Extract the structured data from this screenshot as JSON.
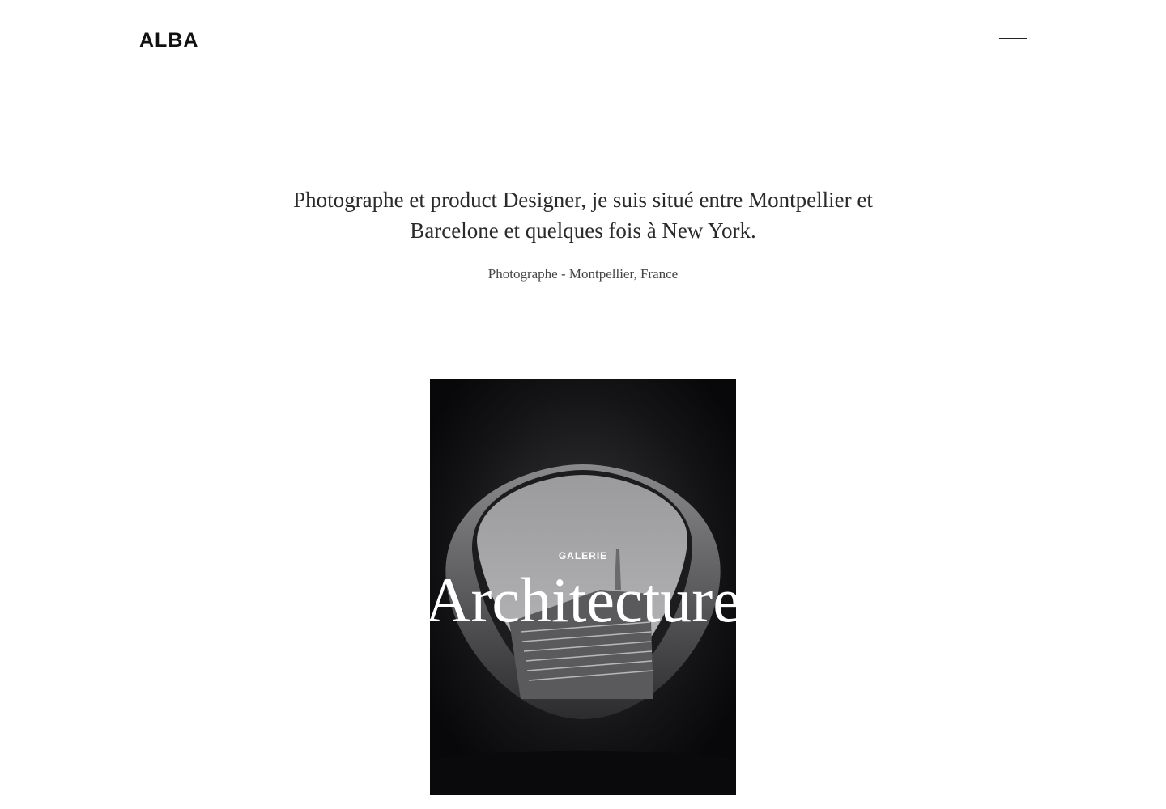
{
  "header": {
    "logo": "ALBA",
    "menu_icon": "hamburger-icon"
  },
  "intro": {
    "text": "Photographe et product Designer, je suis situé entre Montpellier et Barcelone et quelques fois à New York.",
    "subtitle": "Photographe - Montpellier, France"
  },
  "gallery": {
    "label": "GALERIE",
    "title": "Architecture"
  },
  "colors": {
    "background": "#ffffff",
    "text": "#2a2a2a",
    "card_background": "#0b0b0d",
    "overlay_text": "#ffffff"
  }
}
